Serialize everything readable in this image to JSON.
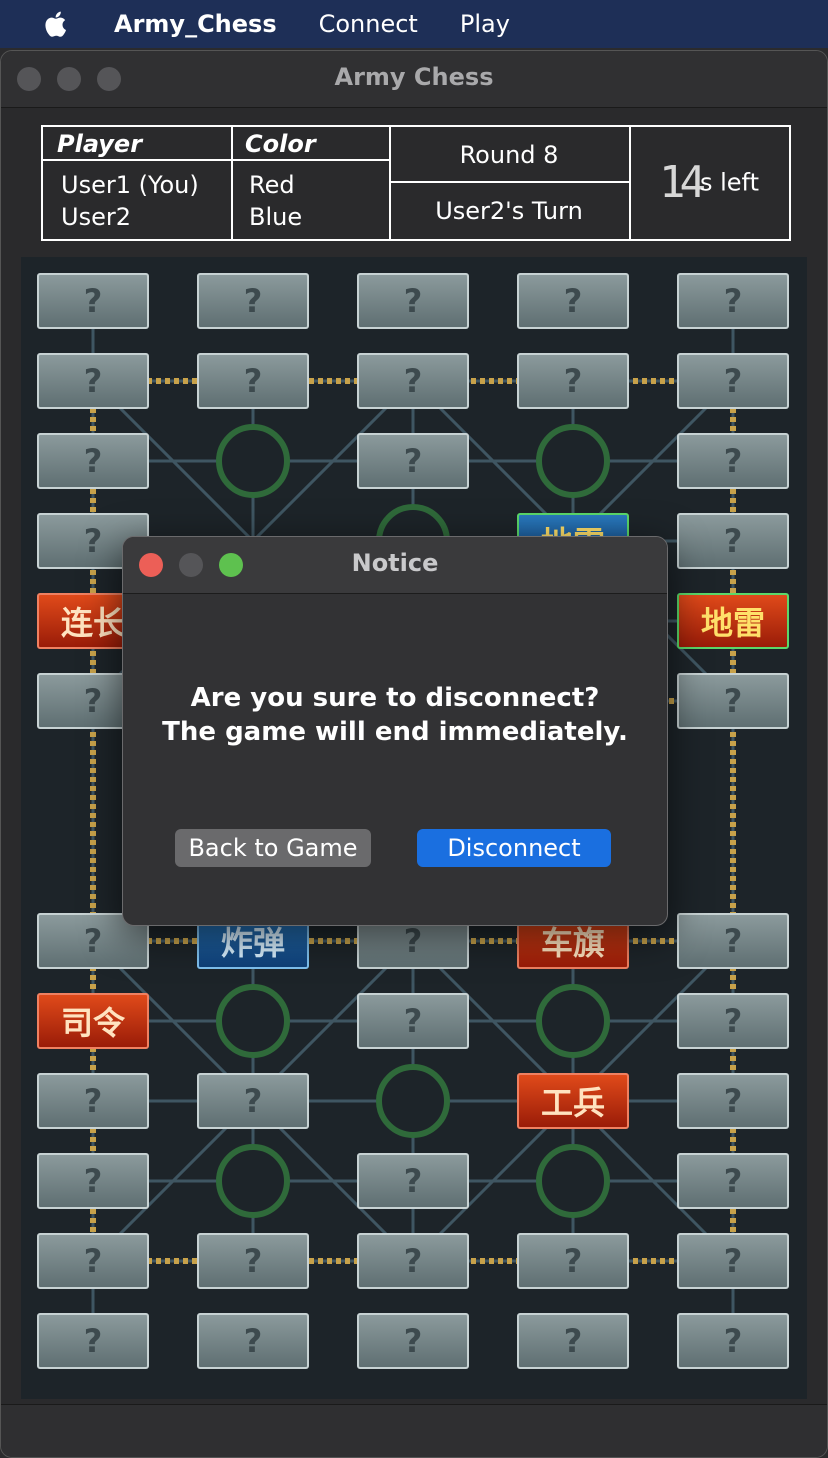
{
  "menubar": {
    "app_name": "Army_Chess",
    "items": [
      "Connect",
      "Play"
    ]
  },
  "window": {
    "title": "Army Chess"
  },
  "info": {
    "player_header": "Player",
    "color_header": "Color",
    "players": [
      {
        "name": "User1 (You)",
        "color": "Red"
      },
      {
        "name": "User2",
        "color": "Blue"
      }
    ],
    "round": "Round 8",
    "turn": "User2's Turn",
    "timer_value": "14",
    "timer_suffix": "s left"
  },
  "board": {
    "pieces": [
      [
        "?",
        "?",
        "?",
        "?",
        "?"
      ],
      [
        "?",
        "?",
        "?",
        "?",
        "?"
      ],
      [
        "?",
        "",
        "?",
        "",
        "?"
      ],
      [
        "?",
        "",
        "",
        "地雷",
        "?"
      ],
      [
        "连长",
        "",
        "",
        "",
        "地雷"
      ],
      [
        "?",
        "",
        "",
        "",
        "?"
      ],
      [
        "?",
        "炸弹",
        "?",
        "车旗",
        "?"
      ],
      [
        "司令",
        "",
        "?",
        "",
        "?"
      ],
      [
        "?",
        "?",
        "",
        "工兵",
        "?"
      ],
      [
        "?",
        "",
        "?",
        "",
        "?"
      ],
      [
        "?",
        "?",
        "?",
        "?",
        "?"
      ],
      [
        "?",
        "?",
        "?",
        "?",
        "?"
      ]
    ]
  },
  "dialog": {
    "title": "Notice",
    "message_line1": "Are you sure to disconnect?",
    "message_line2": "The game will end immediately.",
    "back_label": "Back to Game",
    "disconnect_label": "Disconnect"
  },
  "colors": {
    "menubar_bg": "#1e2f57",
    "primary_button": "#1a6fe0",
    "close_red": "#ec5f57",
    "zoom_green": "#5ec14f"
  }
}
